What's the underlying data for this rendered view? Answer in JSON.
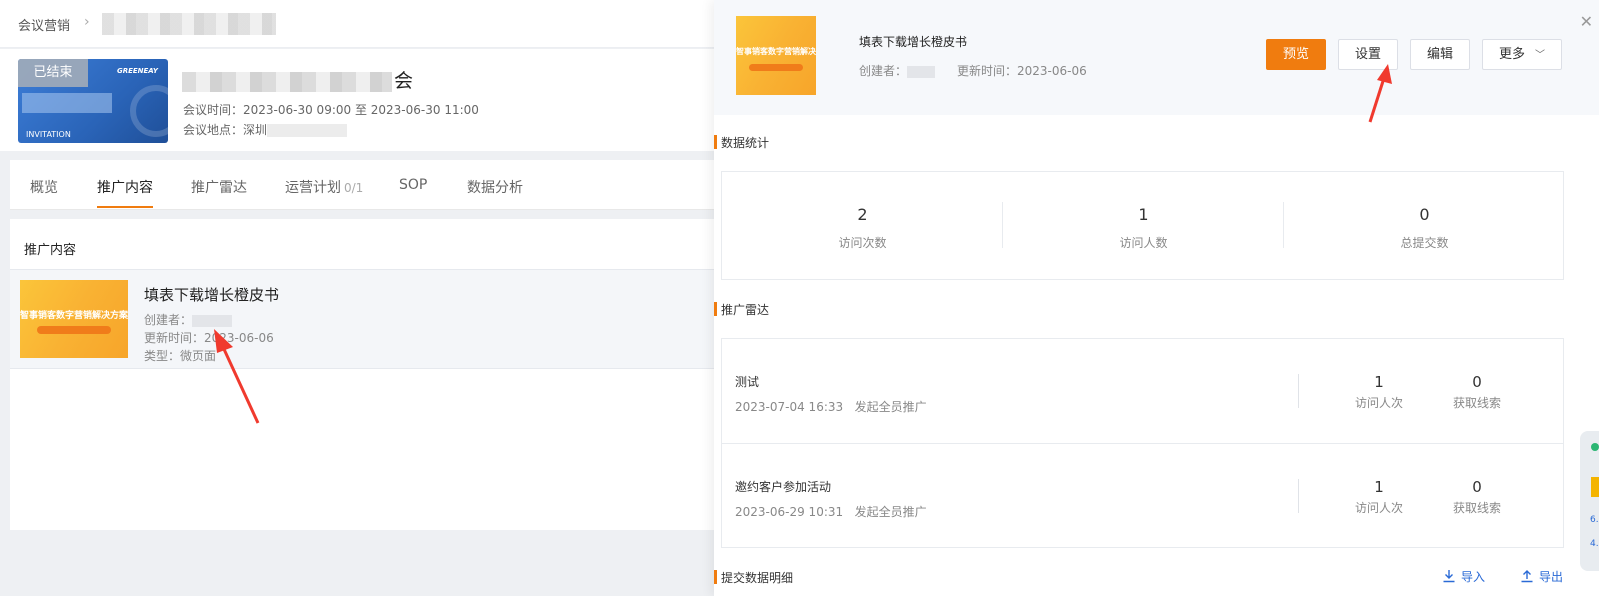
{
  "breadcrumb": {
    "root": "会议营销",
    "separator": "›"
  },
  "meeting": {
    "card_status": "已结束",
    "card_brand": "GREENEAY",
    "card_invite": "INVITATION",
    "title_visible_suffix": "会",
    "time_label": "会议时间：2023-06-30 09:00 至 2023-06-30 11:00",
    "location_label": "会议地点：深圳"
  },
  "tabs": [
    {
      "label": "概览"
    },
    {
      "label": "推广内容",
      "active": true
    },
    {
      "label": "推广雷达"
    },
    {
      "label": "运营计划",
      "sub": "0/1"
    },
    {
      "label": "SOP"
    },
    {
      "label": "数据分析"
    }
  ],
  "content": {
    "heading": "推广内容",
    "item": {
      "thumb_title": "智事销客数字营销解决方案",
      "name": "填表下载增长橙皮书",
      "creator_label": "创建者：",
      "updated": "更新时间：2023-06-06",
      "type": "类型：微页面"
    }
  },
  "drawer": {
    "title": "填表下载增长橙皮书",
    "creator_label": "创建者：",
    "updated": "更新时间：2023-06-06",
    "buttons": {
      "preview": "预览",
      "settings": "设置",
      "edit": "编辑",
      "more": "更多"
    },
    "close": "✕",
    "stats_title": "数据统计",
    "stats": [
      {
        "value": "2",
        "label": "访问次数"
      },
      {
        "value": "1",
        "label": "访问人数"
      },
      {
        "value": "0",
        "label": "总提交数"
      }
    ],
    "radar_title": "推广雷达",
    "radar": [
      {
        "name": "测试",
        "time": "2023-07-04 16:33",
        "action": "发起全员推广",
        "visitors": "1",
        "visitors_label": "访问人次",
        "leads": "0",
        "leads_label": "获取线索"
      },
      {
        "name": "邀约客户参加活动",
        "time": "2023-06-29 10:31",
        "action": "发起全员推广",
        "visitors": "1",
        "visitors_label": "访问人次",
        "leads": "0",
        "leads_label": "获取线索"
      }
    ],
    "detail_title": "提交数据明细",
    "import_label": "导入",
    "export_label": "导出"
  },
  "colors": {
    "accent": "#f07c0f",
    "link": "#2a6ad6",
    "annotation_arrow": "#f03a2e"
  },
  "side_widget": {
    "t1": "6.",
    "t2": "4."
  }
}
